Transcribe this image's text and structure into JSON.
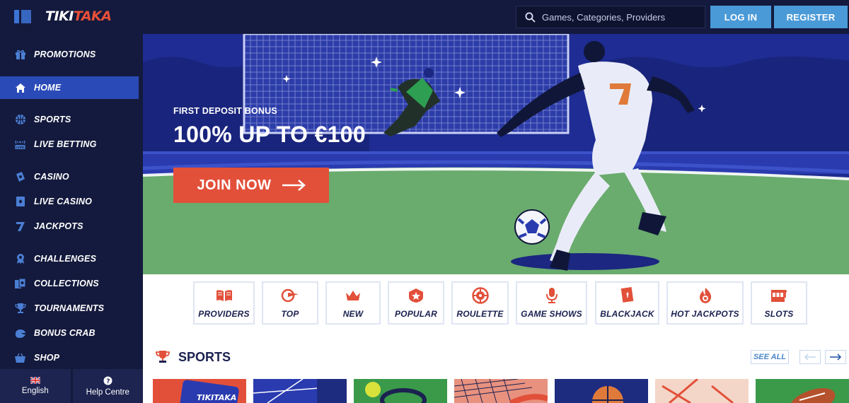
{
  "header": {
    "logo_part1": "TIKI",
    "logo_part2": "TAKA",
    "search_placeholder": "Games, Categories, Providers",
    "login_label": "LOG IN",
    "register_label": "REGISTER"
  },
  "sidebar": {
    "items": [
      {
        "label": "PROMOTIONS",
        "icon": "gift-icon"
      },
      {
        "label": "HOME",
        "icon": "home-icon",
        "active": true
      },
      {
        "label": "SPORTS",
        "icon": "basketball-icon"
      },
      {
        "label": "LIVE BETTING",
        "icon": "live-tv-icon"
      },
      {
        "label": "CASINO",
        "icon": "chip-icon"
      },
      {
        "label": "LIVE CASINO",
        "icon": "card-icon"
      },
      {
        "label": "JACKPOTS",
        "icon": "seven-icon"
      },
      {
        "label": "CHALLENGES",
        "icon": "medal-icon"
      },
      {
        "label": "COLLECTIONS",
        "icon": "album-icon"
      },
      {
        "label": "TOURNAMENTS",
        "icon": "trophy-icon"
      },
      {
        "label": "BONUS CRAB",
        "icon": "crab-claw-icon"
      },
      {
        "label": "SHOP",
        "icon": "basket-icon"
      }
    ],
    "footer": {
      "language_label": "English",
      "help_label": "Help Centre"
    }
  },
  "hero": {
    "kicker": "FIRST DEPOSIT BONUS",
    "title": "100% UP TO €100",
    "cta_label": "JOIN NOW"
  },
  "categories": [
    {
      "label": "PROVIDERS",
      "icon": "book-icon"
    },
    {
      "label": "TOP",
      "icon": "flag-icon"
    },
    {
      "label": "NEW",
      "icon": "crown-icon"
    },
    {
      "label": "POPULAR",
      "icon": "star-badge-icon"
    },
    {
      "label": "ROULETTE",
      "icon": "roulette-icon"
    },
    {
      "label": "GAME SHOWS",
      "icon": "microphone-icon"
    },
    {
      "label": "BLACKJACK",
      "icon": "playing-card-icon"
    },
    {
      "label": "HOT JACKPOTS",
      "icon": "flame-icon"
    },
    {
      "label": "SLOTS",
      "icon": "slot-machine-icon"
    }
  ],
  "sports": {
    "title": "SPORTS",
    "see_all": "SEE ALL",
    "card_logo": "TIKITAKA"
  },
  "colors": {
    "navy": "#141a3d",
    "active_blue": "#2a4ab8",
    "accent_blue": "#4a9ad8",
    "cta_red": "#e2503a",
    "pitch_green": "#6aab6e"
  }
}
